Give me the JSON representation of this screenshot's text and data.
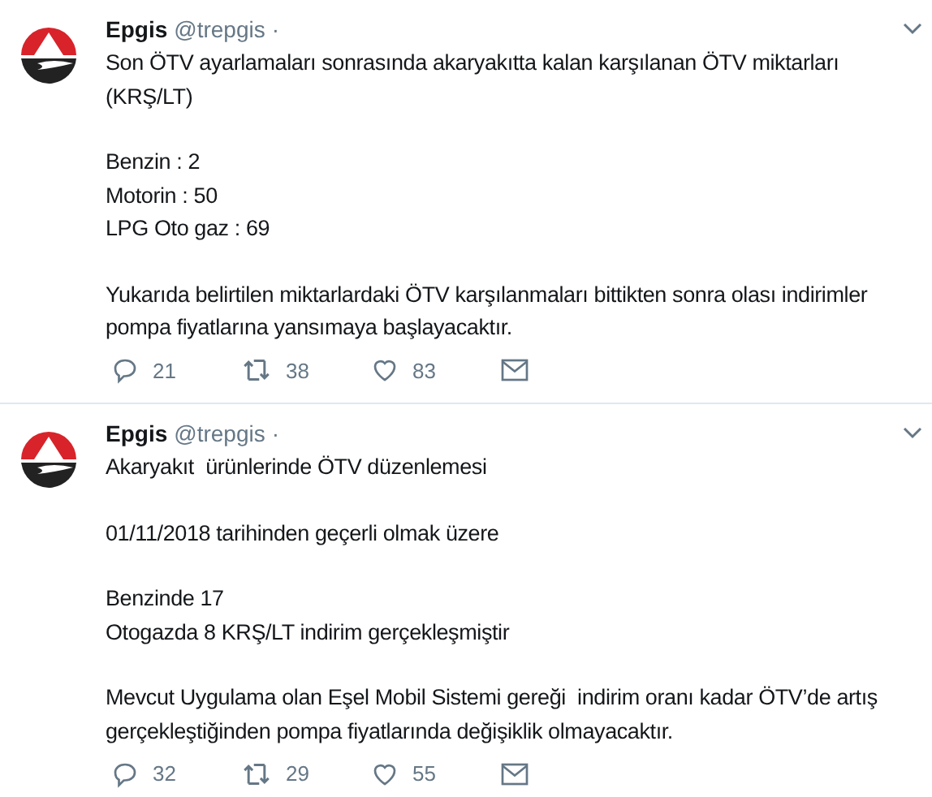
{
  "tweets": [
    {
      "name": "Epgis",
      "handle": "@trepgis",
      "dot": "·",
      "paragraphs": [
        [
          "Son ÖTV ayarlamaları sonrasında akaryakıtta kalan karşılanan ÖTV miktarları",
          "(KRŞ/LT)"
        ],
        [
          "Benzin : 2",
          "Motorin : 50",
          "LPG Oto gaz : 69"
        ],
        [
          "Yukarıda belirtilen miktarlardaki ÖTV karşılanmaları bittikten sonra olası indirimler",
          "pompa fiyatlarına yansımaya başlayacaktır."
        ]
      ],
      "replies": "21",
      "retweets": "38",
      "likes": "83"
    },
    {
      "name": "Epgis",
      "handle": "@trepgis",
      "dot": "·",
      "paragraphs": [
        [
          "Akaryakıt  ürünlerinde ÖTV düzenlemesi"
        ],
        [
          "01/11/2018 tarihinden geçerli olmak üzere"
        ],
        [
          "Benzinde 17",
          "Otogazda 8 KRŞ/LT indirim gerçekleşmiştir"
        ],
        [
          "Mevcut Uygulama olan Eşel Mobil Sistemi gereği  indirim oranı kadar ÖTV’de artış",
          "gerçekleştiğinden pompa fiyatlarında değişiklik olmayacaktır."
        ]
      ],
      "replies": "32",
      "retweets": "29",
      "likes": "55"
    }
  ]
}
